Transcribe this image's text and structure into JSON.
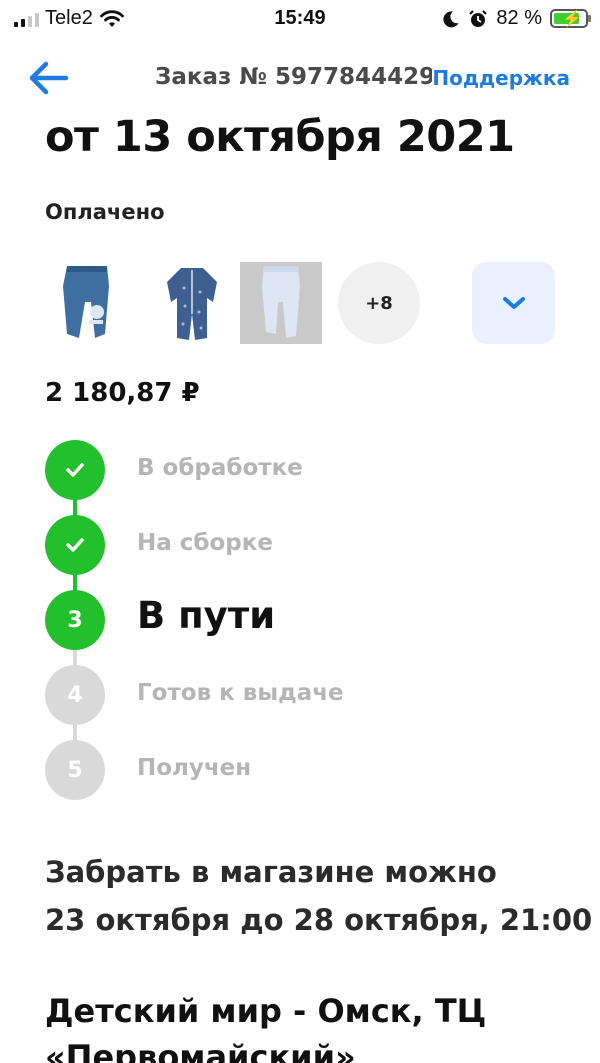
{
  "status_bar": {
    "carrier": "Tele2",
    "time": "15:49",
    "battery_percent": "82 %",
    "battery_level": 0.82,
    "icons": [
      "signal-icon",
      "wifi-icon",
      "moon-icon",
      "alarm-icon",
      "battery-charging-icon"
    ]
  },
  "header": {
    "back_icon": "arrow-left-icon",
    "order_title": "Заказ № 5977844429",
    "support_label": "Поддержка"
  },
  "order": {
    "date_title": "от 13 октября 2021",
    "payment_status": "Оплачено",
    "more_items": "+8",
    "expand_icon": "chevron-down-icon",
    "price": "2 180,87 ₽"
  },
  "steps": [
    {
      "label": "В обработке",
      "state": "done",
      "marker": "check"
    },
    {
      "label": "На сборке",
      "state": "done",
      "marker": "check"
    },
    {
      "label": "В пути",
      "state": "active",
      "marker": "3"
    },
    {
      "label": "Готов к выдаче",
      "state": "pending",
      "marker": "4"
    },
    {
      "label": "Получен",
      "state": "pending",
      "marker": "5"
    }
  ],
  "pickup": {
    "line1": "Забрать в магазине можно",
    "line2": "23 октября до 28 октября, 21:00"
  },
  "store": {
    "name": "Детский мир - Омск, ТЦ «Первомайский»"
  },
  "colors": {
    "accent": "#1e7be0",
    "step_done": "#22c02c",
    "step_pending": "#d9d9d9"
  }
}
